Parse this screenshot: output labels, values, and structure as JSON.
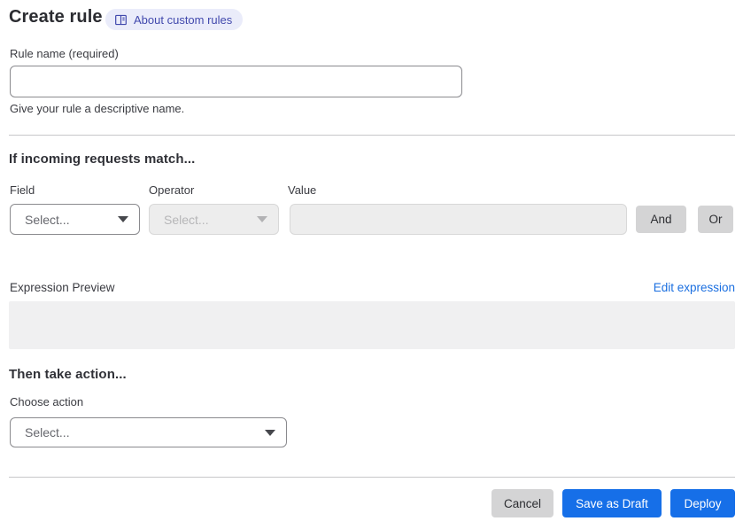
{
  "header": {
    "title": "Create rule",
    "about_badge_label": "About custom rules",
    "about_badge_icon": "book-icon"
  },
  "rule_name": {
    "label": "Rule name (required)",
    "value": "",
    "helper": "Give your rule a descriptive name."
  },
  "match_section": {
    "heading": "If incoming requests match...",
    "field": {
      "label": "Field",
      "selected": "Select...",
      "enabled": true
    },
    "operator": {
      "label": "Operator",
      "selected": "Select...",
      "enabled": false
    },
    "value": {
      "label": "Value",
      "value": "",
      "enabled": false
    },
    "and_button_label": "And",
    "or_button_label": "Or",
    "expression_preview_label": "Expression Preview",
    "edit_expression_label": "Edit expression",
    "expression_preview_value": ""
  },
  "action_section": {
    "heading": "Then take action...",
    "choose_action_label": "Choose action",
    "action_selected": "Select..."
  },
  "footer": {
    "cancel_label": "Cancel",
    "save_draft_label": "Save as Draft",
    "deploy_label": "Deploy"
  },
  "colors": {
    "primary_button_blue": "#166fe8",
    "link_blue": "#1b6fe0",
    "badge_background": "#eaecfa",
    "badge_text": "#4149ad",
    "neutral_button_gray": "#d4d4d5",
    "disabled_fill": "#ededed",
    "preview_fill": "#f0f0f1"
  }
}
